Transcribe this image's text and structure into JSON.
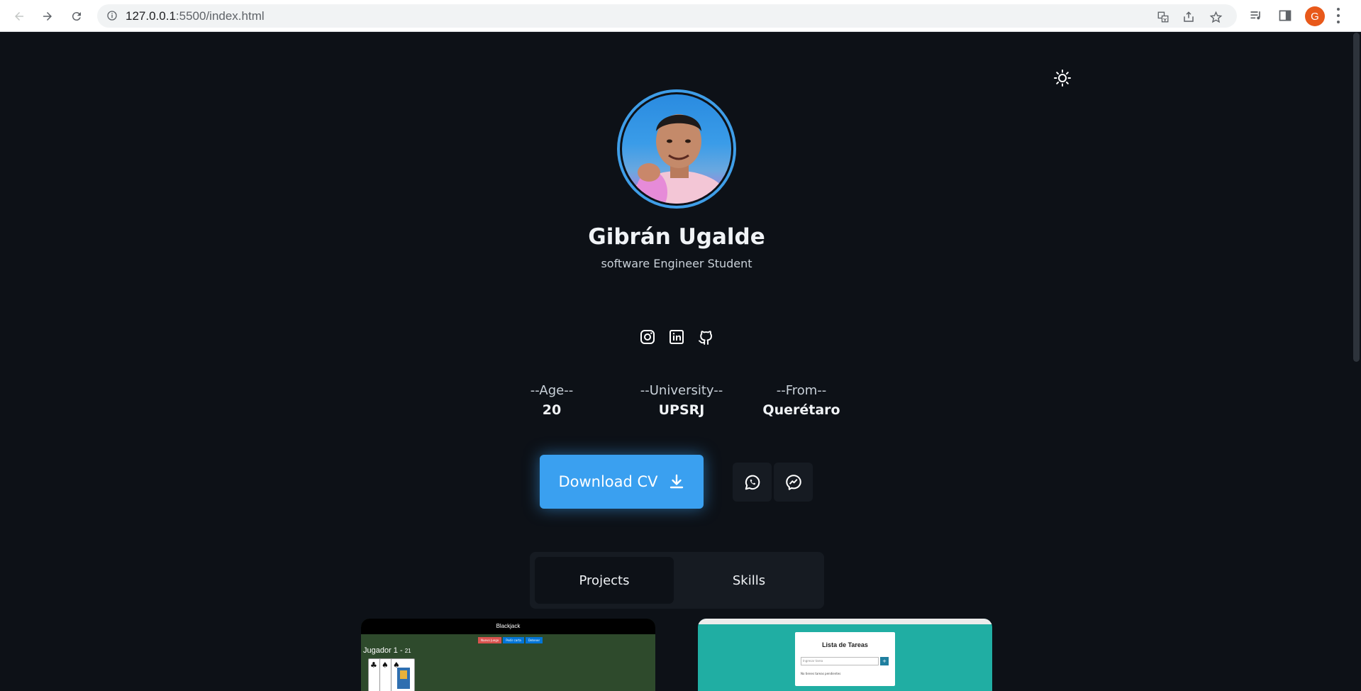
{
  "browser": {
    "url_host": "127.0.0.1",
    "url_path": ":5500/index.html",
    "avatar_letter": "G"
  },
  "profile": {
    "name": "Gibrán Ugalde",
    "subtitle": "software Engineer Student"
  },
  "socials": [
    "instagram-icon",
    "linkedin-icon",
    "github-icon"
  ],
  "stats": [
    {
      "label": "--Age--",
      "value": "20"
    },
    {
      "label": "--University--",
      "value": "UPSRJ"
    },
    {
      "label": "--From--",
      "value": "Querétaro"
    }
  ],
  "actions": {
    "download_label": "Download CV",
    "whatsapp_icon": "whatsapp-icon",
    "messenger_icon": "messenger-icon"
  },
  "tabs": [
    {
      "label": "Projects",
      "active": true
    },
    {
      "label": "Skills",
      "active": false
    }
  ],
  "projects": {
    "blackjack": {
      "header": "Blackjack",
      "buttons": [
        "Nuevo Juego",
        "Pedir carta",
        "Detener"
      ],
      "player": "Jugador 1 - ",
      "score": "21"
    },
    "todo": {
      "title": "Lista de Tareas",
      "placeholder": "Ingresar tarea",
      "add": "+",
      "empty": "No tienes tareas pendientes"
    }
  },
  "colors": {
    "background": "#0d1117",
    "accent": "#3aa0f0",
    "surface": "#161b22"
  }
}
